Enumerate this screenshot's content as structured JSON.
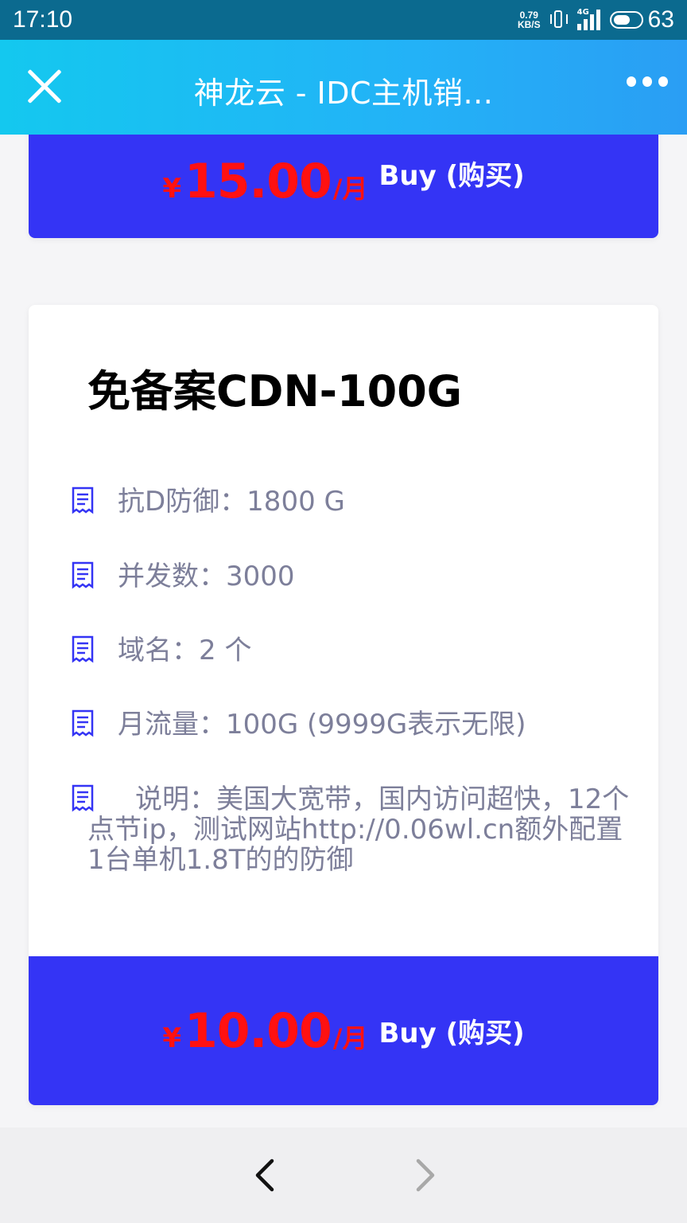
{
  "status_bar": {
    "time": "17:10",
    "net_speed_value": "0.79",
    "net_speed_unit": "KB/S",
    "network_tag": "4G",
    "battery_percent": "63",
    "battery_level": 0.63
  },
  "header": {
    "title": "神龙云 - IDC主机销...",
    "close_icon": "close-icon",
    "more_icon": "more-icon"
  },
  "top_card": {
    "price": {
      "currency": "¥",
      "amount": "15.00",
      "period": "/月"
    },
    "buy_label": "Buy (购买)"
  },
  "product_card": {
    "title": "免备案CDN-100G",
    "features": [
      {
        "icon": "receipt-icon",
        "text": "抗D防御：1800 G"
      },
      {
        "icon": "receipt-icon",
        "text": "并发数：3000"
      },
      {
        "icon": "receipt-icon",
        "text": "域名：2 个"
      },
      {
        "icon": "receipt-icon",
        "text": "月流量：100G (9999G表示无限)"
      },
      {
        "icon": "receipt-icon",
        "text": "说明：美国大宽带，国内访问超快，12个点节ip，测试网站http://0.06wl.cn额外配置1台单机1.8T的的防御"
      }
    ],
    "price": {
      "currency": "¥",
      "amount": "10.00",
      "period": "/月"
    },
    "buy_label": "Buy (购买)"
  },
  "bottom_nav": {
    "back_icon": "chevron-left-icon",
    "forward_icon": "chevron-right-icon"
  },
  "colors": {
    "buy_bar": "#3434f5",
    "price": "#ff1111",
    "feature_text": "#7d7f9a",
    "header_start": "#14c8ef",
    "header_end": "#2a9ef4"
  }
}
